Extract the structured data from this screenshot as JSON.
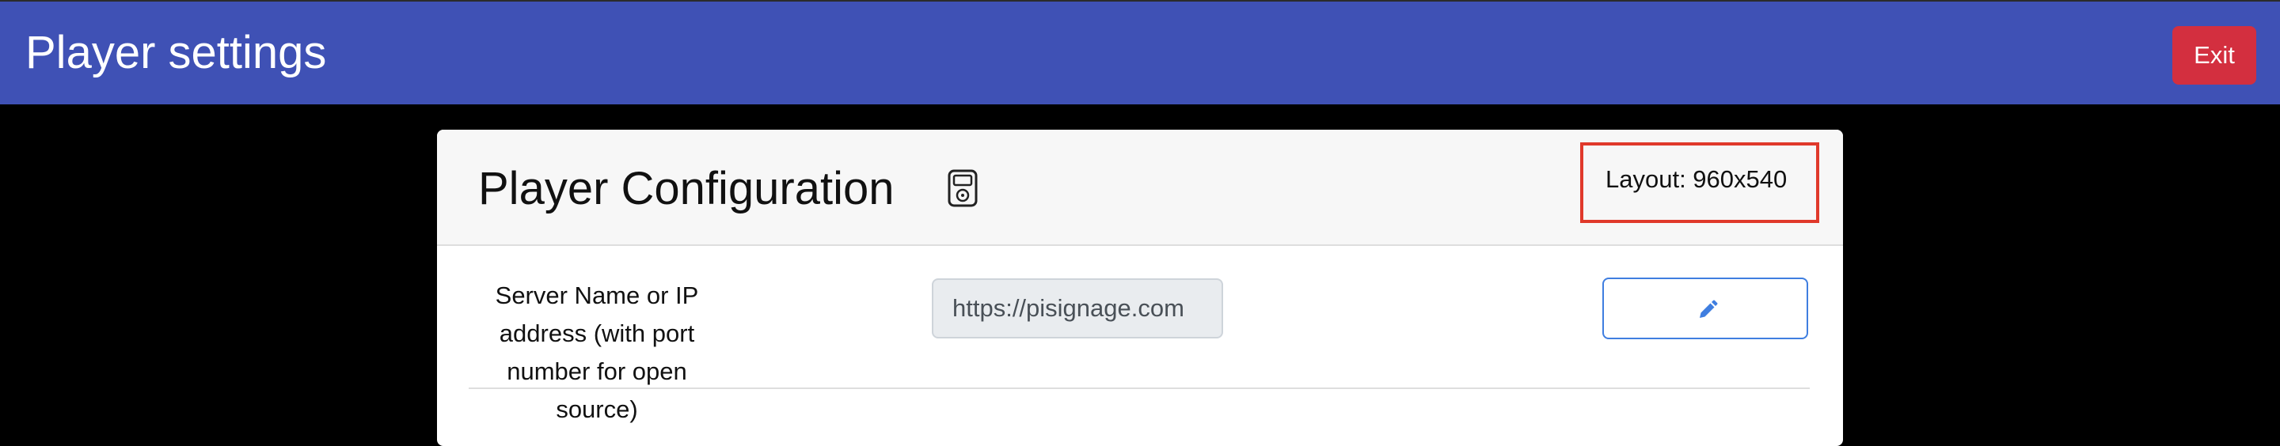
{
  "topbar": {
    "title": "Player settings",
    "exit_label": "Exit"
  },
  "card": {
    "title": "Player Configuration",
    "title_icon": "media-player-icon",
    "layout_label": "Layout: 960x540",
    "server_row": {
      "label": "Server Name or IP address (with port number for open source)",
      "value": "https://pisignage.com",
      "edit_icon": "pencil-icon"
    }
  },
  "colors": {
    "topbar_bg": "#3f51b5",
    "exit_bg": "#d32f3f",
    "highlight_border": "#e0392b",
    "edit_accent": "#3f7ee0"
  }
}
